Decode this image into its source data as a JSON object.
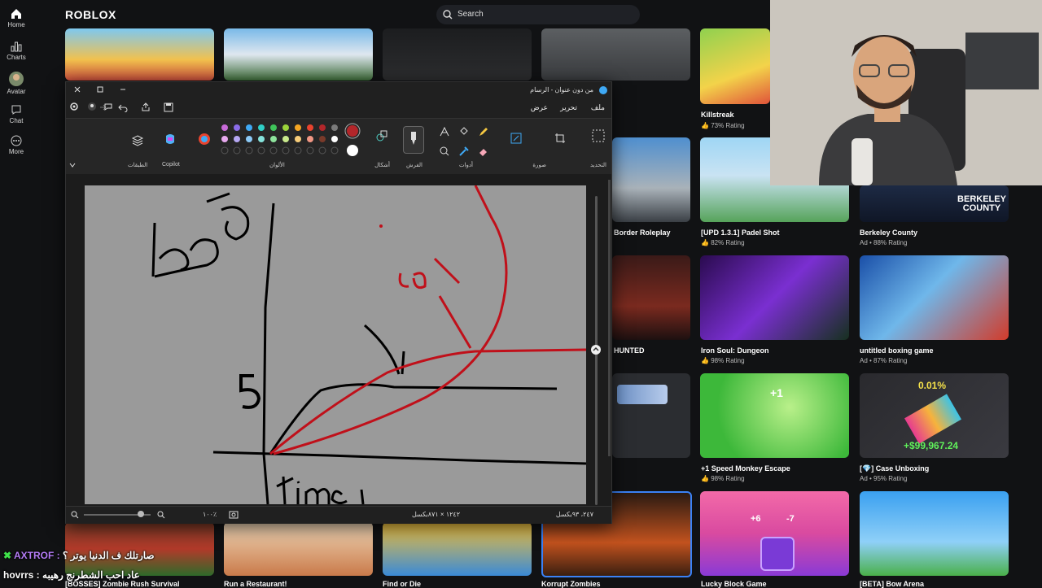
{
  "sidebar": {
    "items": [
      {
        "label": "Home"
      },
      {
        "label": "Charts"
      },
      {
        "label": "Avatar"
      },
      {
        "label": "Chat"
      },
      {
        "label": "More"
      }
    ]
  },
  "header": {
    "logo": "ROBLOX",
    "search_placeholder": "Search"
  },
  "games": [
    {
      "title": "Killstreak",
      "rating": "73% Rating"
    },
    {
      "title": "Border Roleplay",
      "rating": ""
    },
    {
      "title": "[UPD 1.3.1] Padel Shot",
      "rating": "82% Rating"
    },
    {
      "title": "Berkeley County",
      "rating": "Ad • 88% Rating"
    },
    {
      "title": "HUNTED",
      "rating": ""
    },
    {
      "title": "Iron Soul: Dungeon",
      "rating": "98% Rating"
    },
    {
      "title": "untitled boxing game",
      "rating": "Ad • 87% Rating"
    },
    {
      "title": "+1 Speed Monkey Escape",
      "rating": "98% Rating"
    },
    {
      "title": "[💎] Case Unboxing",
      "rating": "Ad • 95% Rating"
    },
    {
      "title": "[BOSSES] Zombie Rush Survival",
      "rating": ""
    },
    {
      "title": "Run a Restaurant!",
      "rating": ""
    },
    {
      "title": "Find or Die",
      "rating": ""
    },
    {
      "title": "Korrupt Zombies",
      "rating": ""
    },
    {
      "title": "Lucky Block Game",
      "rating": ""
    },
    {
      "title": "[BETA] Bow Arena",
      "rating": ""
    }
  ],
  "tile_text": {
    "berkeley": "BERKELEY COUNTY",
    "case_pct": "0.01%",
    "case_money": "+$99,967.24",
    "lucky_a": "+6",
    "lucky_b": "-7",
    "monkey": "+1"
  },
  "paint": {
    "title": "من دون عنوان - الرسام",
    "menu": [
      "ملف",
      "تحرير",
      "عرض"
    ],
    "groups": [
      "التحديد",
      "صورة",
      "أدوات",
      "الفرش",
      "أشكال",
      "الألوان",
      "Copilot",
      "الطبقات"
    ],
    "status_cursor": "٢٤٧، ٩٣بكسل",
    "status_size": "١٢٤٢ × ٨٧١بكسل",
    "zoom": "١٠٠٪"
  },
  "chat": [
    {
      "user": "AXTROF :",
      "message": "صارتلك ف الدنيا يوتر ؟"
    },
    {
      "user": "hovrrs :",
      "message": "عاد احب الشطرنج رهيبه"
    }
  ],
  "colors": {
    "paint_bg": "#202020",
    "canvas": "#9a9a9a",
    "ink_black": "#000000",
    "ink_red": "#c0101a",
    "accent": "#3b82f6"
  }
}
